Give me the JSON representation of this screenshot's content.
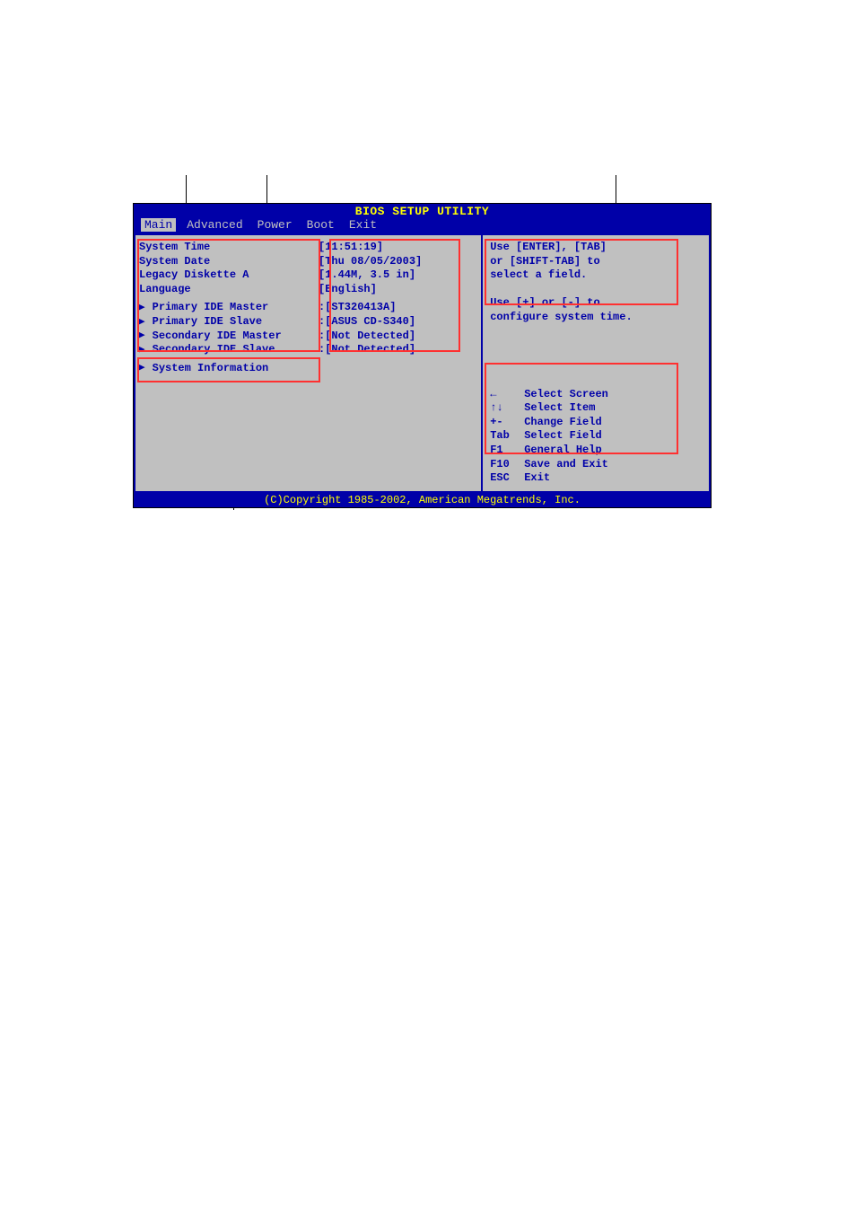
{
  "title": "BIOS SETUP UTILITY",
  "menu": {
    "items": [
      "Main",
      "Advanced",
      "Power",
      "Boot",
      "Exit"
    ],
    "active_index": 0
  },
  "fields": {
    "basic": [
      {
        "label": "System Time",
        "value": "[11:51:19]",
        "arrow": false
      },
      {
        "label": "System Date",
        "value": "[Thu 08/05/2003]",
        "arrow": false
      },
      {
        "label": "Legacy Diskette A",
        "value": "[1.44M, 3.5 in]",
        "arrow": false
      },
      {
        "label": "Language",
        "value": "[English]",
        "arrow": false
      }
    ],
    "ide": [
      {
        "label": "Primary IDE Master",
        "value": ":[ST320413A]",
        "arrow": true
      },
      {
        "label": "Primary IDE Slave",
        "value": ":[ASUS CD-S340]",
        "arrow": true
      },
      {
        "label": "Secondary IDE Master",
        "value": ":[Not Detected]",
        "arrow": true
      },
      {
        "label": "Secondary IDE Slave",
        "value": ":[Not Detected]",
        "arrow": true
      }
    ],
    "sysinfo": {
      "label": "System Information",
      "value": "",
      "arrow": true
    }
  },
  "help": {
    "line1": "Use [ENTER], [TAB]",
    "line2": "or [SHIFT-TAB] to",
    "line3": "select a field.",
    "line4": "",
    "line5": "Use [+] or [-] to",
    "line6": "configure system time."
  },
  "nav": [
    {
      "key": "←",
      "desc": "Select Screen"
    },
    {
      "key": "↑↓",
      "desc": "Select Item"
    },
    {
      "key": "+-",
      "desc": "Change Field"
    },
    {
      "key": "Tab",
      "desc": "Select Field"
    },
    {
      "key": "F1",
      "desc": "General Help"
    },
    {
      "key": "F10",
      "desc": "Save and Exit"
    },
    {
      "key": "ESC",
      "desc": "Exit"
    }
  ],
  "footer": "(C)Copyright 1985-2002, American Megatrends, Inc."
}
